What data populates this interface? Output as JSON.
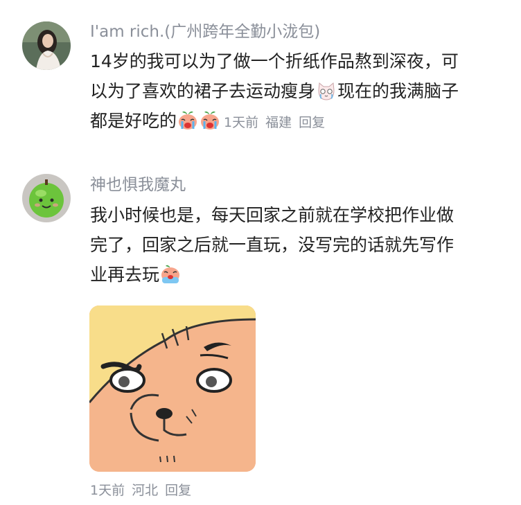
{
  "comments": [
    {
      "username": "I'am rich.(广州跨年全勤小泷包)",
      "lines": [
        "14岁的我可以为了做一个折纸作品熬到深夜，可",
        "以为了喜欢的裙子去运动瘦身",
        "现在的我满脑子",
        "都是好吃的"
      ],
      "time": "1天前",
      "location": "福建",
      "reply_label": "回复"
    },
    {
      "username": "神也惧我魔丸",
      "lines": [
        "我小时候也是，每天回家之前就在学校把作业做",
        "完了，回家之后就一直玩，没写完的话就先写作",
        "业再去玩"
      ],
      "time": "1天前",
      "location": "河北",
      "reply_label": "回复"
    }
  ],
  "colors": {
    "meta": "#8a8f99",
    "text": "#222222",
    "sticker_bg": "#f5b58c"
  },
  "icons": [
    "crying-cat-emoji",
    "crying-peach-emoji",
    "crying-face-emoji",
    "sad-dog-sticker"
  ]
}
